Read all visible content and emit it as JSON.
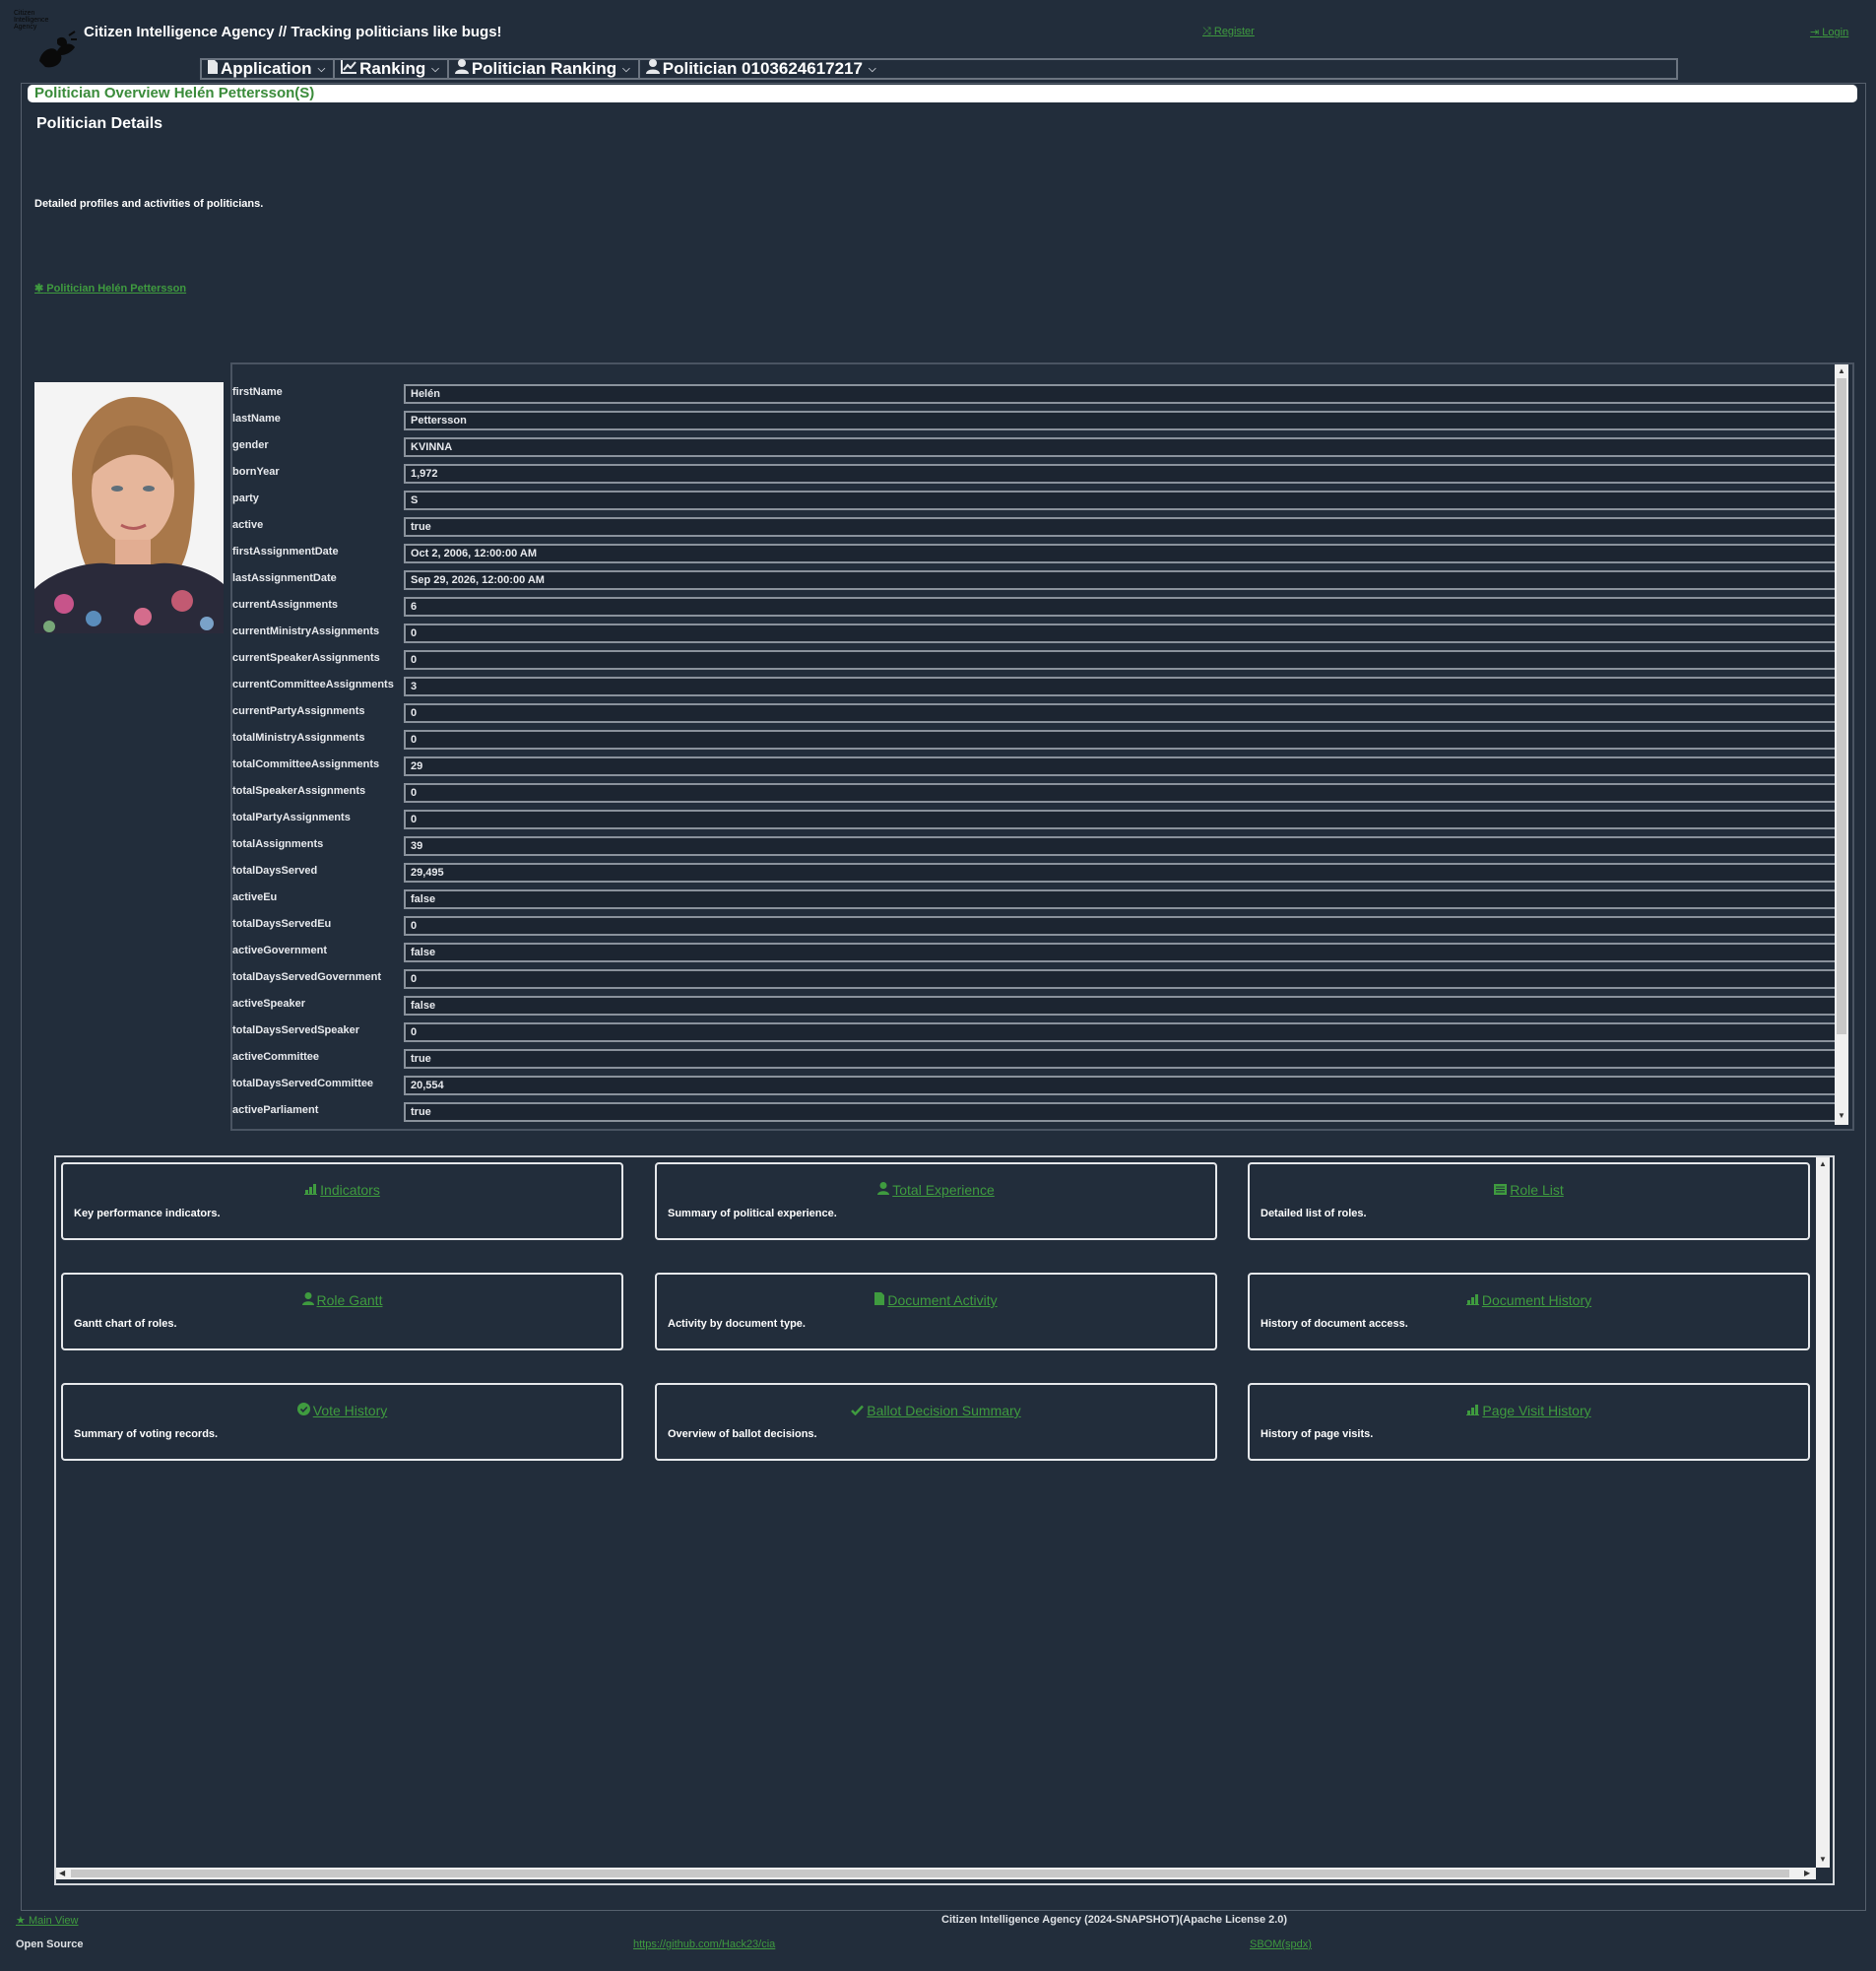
{
  "header": {
    "logo_text": "Citizen Intelligence Agency",
    "title": "Citizen Intelligence Agency  // Tracking politicians like bugs!",
    "register_label": "Register",
    "login_label": "Login"
  },
  "menu": [
    {
      "label": "Application",
      "icon": "document-icon"
    },
    {
      "label": "Ranking",
      "icon": "line-chart-icon"
    },
    {
      "label": "Politician Ranking",
      "icon": "user-icon"
    },
    {
      "label": "Politician 0103624617217",
      "icon": "user-icon"
    }
  ],
  "page": {
    "overview_title": "Politician Overview Helén Pettersson(S)",
    "details_heading": "Politician Details",
    "details_description": "Detailed profiles and activities of politicians.",
    "politician_link": "Politician Helén Pettersson"
  },
  "details": [
    {
      "label": "firstName",
      "value": "Helén"
    },
    {
      "label": "lastName",
      "value": "Pettersson"
    },
    {
      "label": "gender",
      "value": "KVINNA"
    },
    {
      "label": "bornYear",
      "value": "1,972"
    },
    {
      "label": "party",
      "value": "S"
    },
    {
      "label": "active",
      "value": "true"
    },
    {
      "label": "firstAssignmentDate",
      "value": "Oct 2, 2006, 12:00:00 AM"
    },
    {
      "label": "lastAssignmentDate",
      "value": "Sep 29, 2026, 12:00:00 AM"
    },
    {
      "label": "currentAssignments",
      "value": "6"
    },
    {
      "label": "currentMinistryAssignments",
      "value": "0"
    },
    {
      "label": "currentSpeakerAssignments",
      "value": "0"
    },
    {
      "label": "currentCommitteeAssignments",
      "value": "3"
    },
    {
      "label": "currentPartyAssignments",
      "value": "0"
    },
    {
      "label": "totalMinistryAssignments",
      "value": "0"
    },
    {
      "label": "totalCommitteeAssignments",
      "value": "29"
    },
    {
      "label": "totalSpeakerAssignments",
      "value": "0"
    },
    {
      "label": "totalPartyAssignments",
      "value": "0"
    },
    {
      "label": "totalAssignments",
      "value": "39"
    },
    {
      "label": "totalDaysServed",
      "value": "29,495"
    },
    {
      "label": "activeEu",
      "value": "false"
    },
    {
      "label": "totalDaysServedEu",
      "value": "0"
    },
    {
      "label": "activeGovernment",
      "value": "false"
    },
    {
      "label": "totalDaysServedGovernment",
      "value": "0"
    },
    {
      "label": "activeSpeaker",
      "value": "false"
    },
    {
      "label": "totalDaysServedSpeaker",
      "value": "0"
    },
    {
      "label": "activeCommittee",
      "value": "true"
    },
    {
      "label": "totalDaysServedCommittee",
      "value": "20,554"
    },
    {
      "label": "activeParliament",
      "value": "true"
    }
  ],
  "cards": [
    {
      "title": "Indicators",
      "desc": "Key performance indicators.",
      "icon": "bar-chart-icon"
    },
    {
      "title": "Total Experience",
      "desc": "Summary of political experience.",
      "icon": "user-tie-icon"
    },
    {
      "title": "Role List",
      "desc": "Detailed list of roles.",
      "icon": "list-icon"
    },
    {
      "title": "Role Gantt",
      "desc": "Gantt chart of roles.",
      "icon": "user-tie-icon"
    },
    {
      "title": "Document Activity",
      "desc": "Activity by document type.",
      "icon": "document-icon"
    },
    {
      "title": "Document History",
      "desc": "History of document access.",
      "icon": "bar-chart-icon"
    },
    {
      "title": "Vote History",
      "desc": "Summary of voting records.",
      "icon": "check-circle-icon"
    },
    {
      "title": "Ballot Decision Summary",
      "desc": "Overview of ballot decisions.",
      "icon": "check-icon"
    },
    {
      "title": "Page Visit History",
      "desc": "History of page visits.",
      "icon": "bar-chart-icon"
    }
  ],
  "footer": {
    "main_view": "Main View",
    "license": "Citizen Intelligence Agency (2024-SNAPSHOT)(Apache License 2.0)",
    "open_source": "Open Source",
    "github": "https://github.com/Hack23/cia",
    "sbom": "SBOM(spdx)"
  },
  "colors": {
    "background": "#222d3b",
    "accent_green": "#3f9b3f",
    "field_background": "#1c2531"
  }
}
